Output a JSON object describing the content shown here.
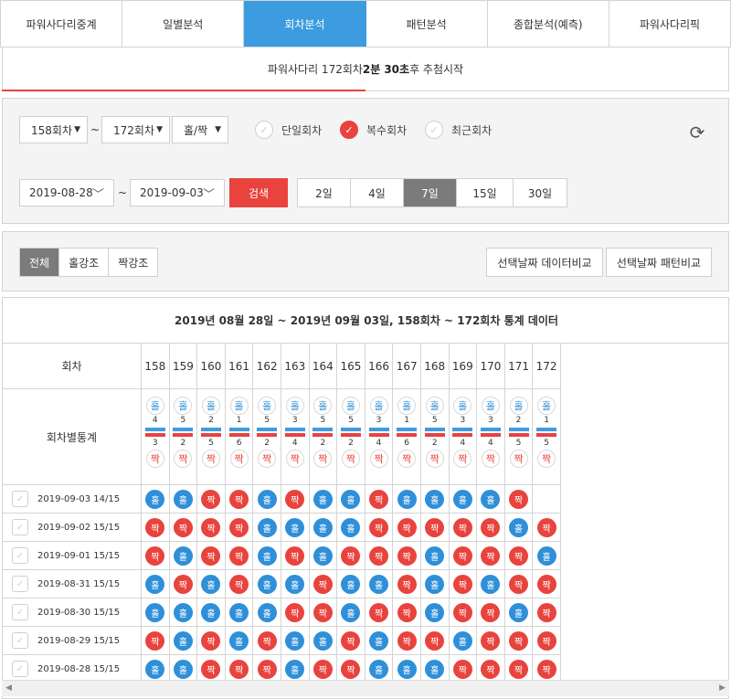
{
  "nav": {
    "tabs": [
      "파워사다리중계",
      "일별분석",
      "회차분석",
      "패턴분석",
      "종합분석(예측)",
      "파워사다리픽"
    ],
    "active_index": 2
  },
  "notice": {
    "prefix": "파워사다리 172회차 ",
    "min_value": "2분",
    "sec_value": "30초",
    "suffix": "후 추첨시작",
    "progress_percent": 50
  },
  "filter": {
    "from_round": "158회차",
    "to_round": "172회차",
    "mode_select": "홀/짝",
    "tilde": "~",
    "options": [
      {
        "label": "단일회차",
        "checked": false
      },
      {
        "label": "복수회차",
        "checked": true
      },
      {
        "label": "최근회차",
        "checked": false
      }
    ],
    "refresh_icon": "refresh-icon",
    "date_from": "2019-08-28",
    "date_to": "2019-09-03",
    "search_label": "검색",
    "day_options": [
      "2일",
      "4일",
      "7일",
      "15일",
      "30일"
    ],
    "day_active_index": 2
  },
  "mode": {
    "tabs": [
      "전체",
      "홀강조",
      "짝강조"
    ],
    "active_index": 0,
    "compare_data": "선택날짜 데이터비교",
    "compare_pattern": "선택날짜 패턴비교"
  },
  "stats": {
    "title": "2019년 08월 28일 ~ 2019년 09월 03일, 158회차 ~ 172회차 통계 데이터",
    "round_header": "회차",
    "stat_header": "회차별통계",
    "odd_label": "홀",
    "even_label": "짝",
    "rounds": [
      "158",
      "159",
      "160",
      "161",
      "162",
      "163",
      "164",
      "165",
      "166",
      "167",
      "168",
      "169",
      "170",
      "171",
      "172"
    ],
    "odd_counts": [
      "4",
      "5",
      "2",
      "1",
      "5",
      "3",
      "5",
      "5",
      "3",
      "1",
      "5",
      "3",
      "3",
      "2",
      "1"
    ],
    "even_counts": [
      "3",
      "2",
      "5",
      "6",
      "2",
      "4",
      "2",
      "2",
      "4",
      "6",
      "2",
      "4",
      "4",
      "5",
      "5"
    ],
    "days": [
      {
        "label": "2019-09-03 14/15",
        "results": [
          "홀",
          "홀",
          "짝",
          "짝",
          "홀",
          "짝",
          "홀",
          "홀",
          "짝",
          "홀",
          "홀",
          "홀",
          "홀",
          "짝"
        ]
      },
      {
        "label": "2019-09-02 15/15",
        "results": [
          "짝",
          "짝",
          "짝",
          "짝",
          "홀",
          "홀",
          "홀",
          "홀",
          "짝",
          "짝",
          "짝",
          "짝",
          "짝",
          "홀",
          "짝"
        ]
      },
      {
        "label": "2019-09-01 15/15",
        "results": [
          "짝",
          "홀",
          "짝",
          "짝",
          "홀",
          "짝",
          "홀",
          "짝",
          "짝",
          "짝",
          "홀",
          "짝",
          "짝",
          "짝",
          "홀"
        ]
      },
      {
        "label": "2019-08-31 15/15",
        "results": [
          "홀",
          "짝",
          "홀",
          "짝",
          "홀",
          "홀",
          "짝",
          "홀",
          "홀",
          "짝",
          "홀",
          "짝",
          "홀",
          "짝",
          "짝"
        ]
      },
      {
        "label": "2019-08-30 15/15",
        "results": [
          "홀",
          "홀",
          "홀",
          "홀",
          "홀",
          "짝",
          "짝",
          "홀",
          "짝",
          "짝",
          "홀",
          "짝",
          "짝",
          "홀",
          "짝"
        ]
      },
      {
        "label": "2019-08-29 15/15",
        "results": [
          "짝",
          "홀",
          "짝",
          "홀",
          "짝",
          "홀",
          "홀",
          "짝",
          "홀",
          "짝",
          "짝",
          "홀",
          "짝",
          "짝",
          "짝"
        ]
      },
      {
        "label": "2019-08-28 15/15",
        "results": [
          "홀",
          "홀",
          "짝",
          "짝",
          "짝",
          "홀",
          "짝",
          "짝",
          "홀",
          "홀",
          "홀",
          "짝",
          "짝",
          "짝",
          "짝"
        ]
      }
    ]
  },
  "colors": {
    "accent_blue": "#3d9be0",
    "odd_blue": "#2f8fd8",
    "even_red": "#e8433d"
  }
}
